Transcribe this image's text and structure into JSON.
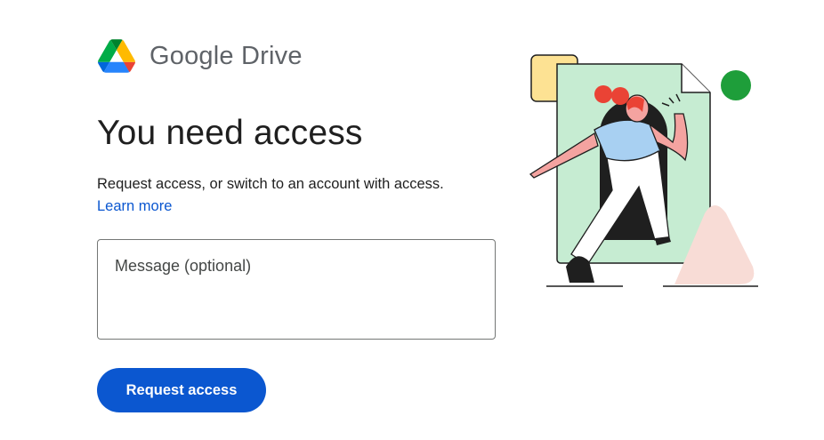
{
  "brand": {
    "logo_icon": "google-drive-logo-icon",
    "name": "Google Drive"
  },
  "main": {
    "title": "You need access",
    "description": "Request access, or switch to an account with access.",
    "learn_more": "Learn more"
  },
  "message": {
    "placeholder": "Message (optional)",
    "value": ""
  },
  "actions": {
    "request_label": "Request access"
  },
  "illustration": {
    "icon": "person-stepping-out-of-document-illustration"
  },
  "colors": {
    "accent": "#0b57d0",
    "link": "#0b57d0",
    "doc_green": "#c6ecd2",
    "sticky_yellow": "#fde293",
    "dot_green": "#1e9e3a",
    "shape_pink": "#f8dcd6",
    "hair_red": "#ea4335",
    "shirt_blue": "#a8d0f2"
  }
}
